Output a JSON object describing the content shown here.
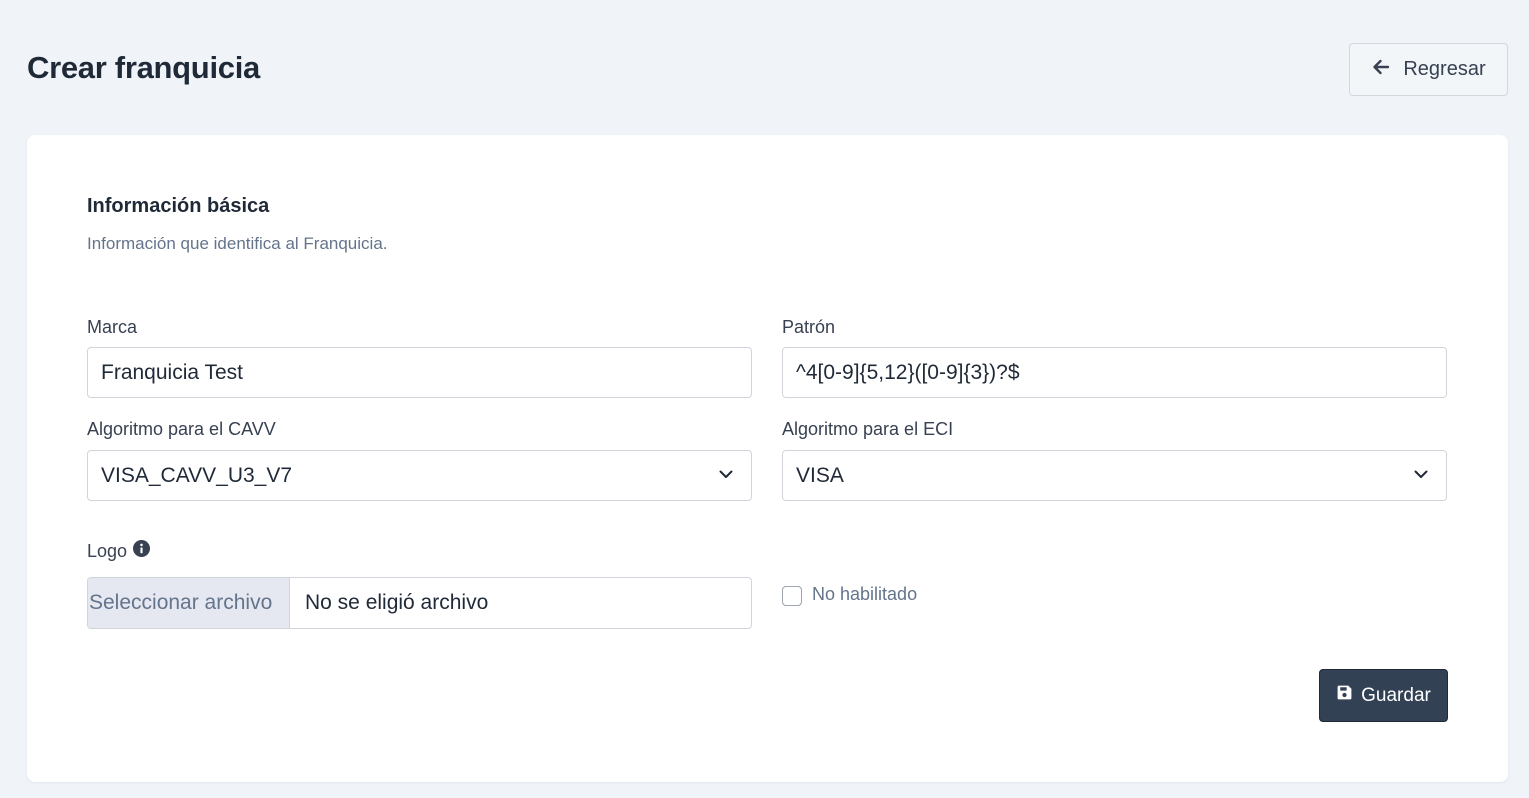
{
  "header": {
    "title": "Crear franquicia",
    "back_label": "Regresar"
  },
  "section": {
    "title": "Información básica",
    "description": "Información que identifica al Franquicia."
  },
  "form": {
    "brand": {
      "label": "Marca",
      "value": "Franquicia Test"
    },
    "pattern": {
      "label": "Patrón",
      "value": "^4[0-9]{5,12}([0-9]{3})?$"
    },
    "cavv": {
      "label": "Algoritmo para el CAVV",
      "value": "VISA_CAVV_U3_V7"
    },
    "eci": {
      "label": "Algoritmo para el ECI",
      "value": "VISA"
    },
    "logo": {
      "label": "Logo",
      "button_label": "Seleccionar archivo",
      "file_name": "No se eligió archivo"
    },
    "enabled": {
      "label": "No habilitado",
      "checked": false
    },
    "save_label": "Guardar"
  },
  "icons": {
    "back": "arrow-left-icon",
    "chevron": "chevron-down-icon",
    "info": "info-circle-icon",
    "save": "floppy-disk-icon"
  },
  "colors": {
    "background": "#f0f4f8",
    "primary_button": "#334155",
    "muted_text": "#64748b"
  }
}
